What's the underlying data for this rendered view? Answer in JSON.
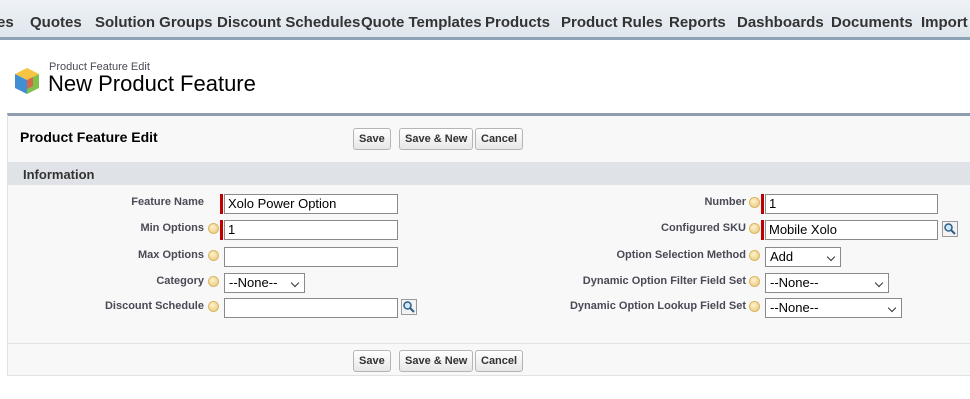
{
  "tabs": [
    "es",
    "Quotes",
    "Solution Groups",
    "Discount Schedules",
    "Quote Templates",
    "Products",
    "Product Rules",
    "Reports",
    "Dashboards",
    "Documents",
    "Import F"
  ],
  "header": {
    "subtitle": "Product Feature Edit",
    "title": "New Product Feature",
    "icon": "product-feature-cube-icon"
  },
  "panel": {
    "title": "Product Feature Edit",
    "buttons": {
      "save": "Save",
      "save_new": "Save & New",
      "cancel": "Cancel"
    },
    "section": "Information"
  },
  "fields": {
    "feature_name": {
      "label": "Feature Name",
      "value": "Xolo Power Option"
    },
    "min_options": {
      "label": "Min Options",
      "value": "1"
    },
    "max_options": {
      "label": "Max Options",
      "value": ""
    },
    "category": {
      "label": "Category",
      "value": "--None--"
    },
    "discount_schedule": {
      "label": "Discount Schedule",
      "value": ""
    },
    "number": {
      "label": "Number",
      "value": "1"
    },
    "configured_sku": {
      "label": "Configured SKU",
      "value": "Mobile Xolo"
    },
    "option_selection_method": {
      "label": "Option Selection Method",
      "value": "Add"
    },
    "dynamic_option_filter_field_set": {
      "label": "Dynamic Option Filter Field Set",
      "value": "--None--"
    },
    "dynamic_option_lookup_field_set": {
      "label": "Dynamic Option Lookup Field Set",
      "value": "--None--"
    }
  },
  "colors": {
    "required": "#c00000",
    "tab_border": "#8da3b6",
    "section_bg": "#dfe3e8"
  }
}
